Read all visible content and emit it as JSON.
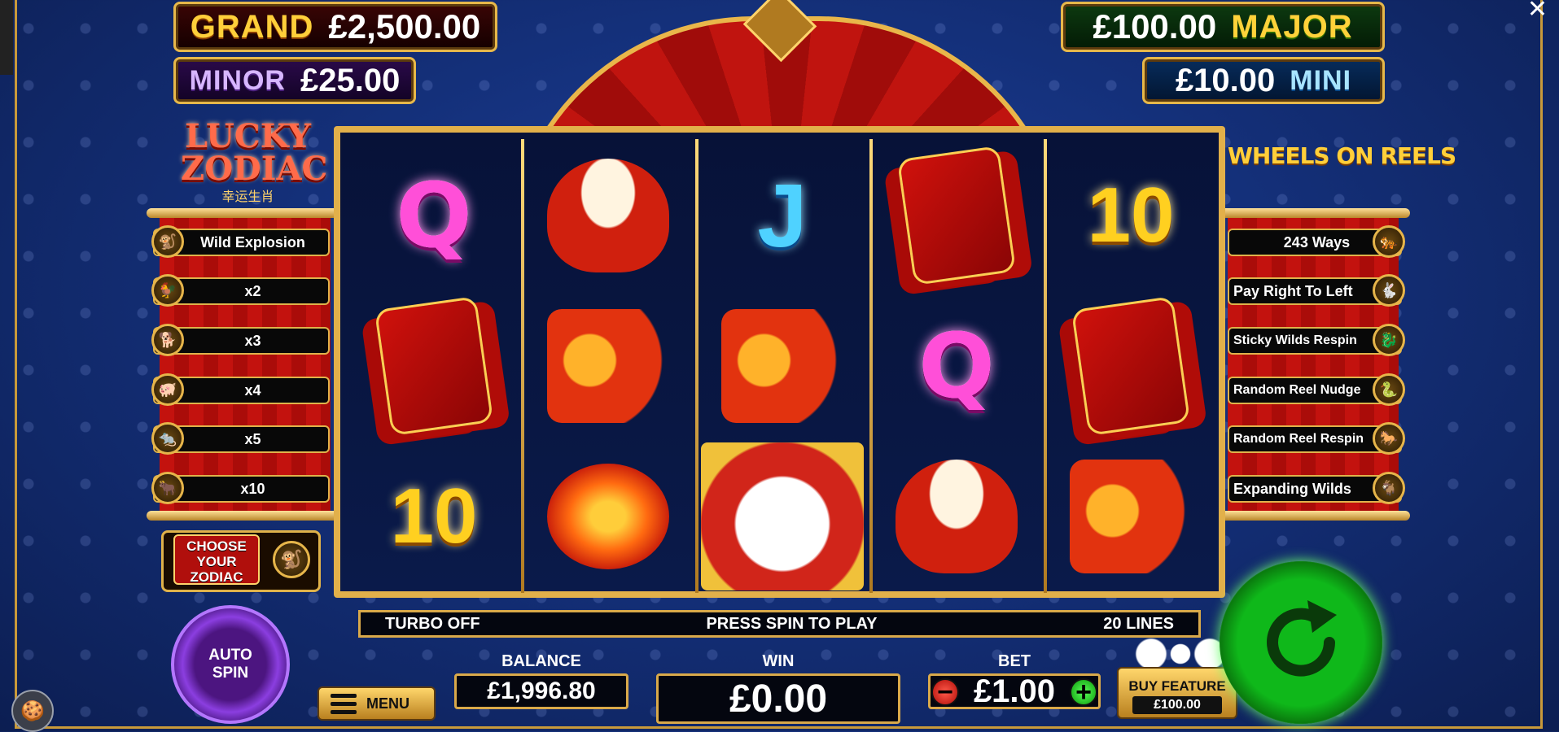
{
  "jackpots": {
    "grand": {
      "label": "GRAND",
      "amount": "£2,500.00"
    },
    "minor": {
      "label": "MINOR",
      "amount": "£25.00"
    },
    "major": {
      "label": "MAJOR",
      "amount": "£100.00"
    },
    "mini": {
      "label": "MINI",
      "amount": "£10.00"
    }
  },
  "logo_left": {
    "line1": "LUCKY",
    "line2": "ZODIAC",
    "line3": "幸运生肖"
  },
  "logo_right": "WHEELS ON REELS",
  "left_features": [
    "Wild Explosion",
    "x2",
    "x3",
    "x4",
    "x5",
    "x10"
  ],
  "right_features": [
    "243 Ways",
    "Pay Right To Left",
    "Sticky Wilds Respin",
    "Random Reel Nudge",
    "Random Reel Respin",
    "Expanding Wilds"
  ],
  "choose_zodiac": "CHOOSE YOUR ZODIAC",
  "reels": [
    [
      "Q",
      "envelopes-icon",
      "10"
    ],
    [
      "drum-icon",
      "fish-icon",
      "lantern-icon"
    ],
    [
      "J",
      "fish-icon",
      "lion-icon"
    ],
    [
      "envelopes-icon",
      "Q",
      "drum-icon"
    ],
    [
      "10",
      "envelopes-icon",
      "fish-icon"
    ]
  ],
  "infobar": {
    "turbo": "TURBO OFF",
    "message": "PRESS SPIN TO PLAY",
    "lines": "20 LINES"
  },
  "controls": {
    "autospin_line1": "AUTO",
    "autospin_line2": "SPIN",
    "menu": "MENU",
    "balance_label": "BALANCE",
    "balance": "£1,996.80",
    "win_label": "WIN",
    "win": "£0.00",
    "bet_label": "BET",
    "bet": "£1.00",
    "minus": "−",
    "plus": "+",
    "buy_feature": "BUY FEATURE",
    "buy_price": "£100.00"
  },
  "colors": {
    "spin": "#0fb81a",
    "autospin": "#8b3ee0",
    "gold": "#e2b04a"
  }
}
